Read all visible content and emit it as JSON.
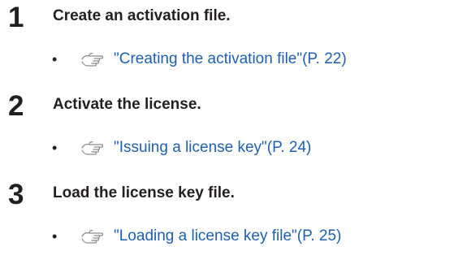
{
  "steps": [
    {
      "number": "1",
      "title": "Create an activation file.",
      "reference": {
        "icon": "reference-hand-icon",
        "link_text": "\"Creating the activation file\"(P. 22)"
      }
    },
    {
      "number": "2",
      "title": "Activate the license.",
      "reference": {
        "icon": "reference-hand-icon",
        "link_text": "\"Issuing a license key\"(P. 24)"
      }
    },
    {
      "number": "3",
      "title": "Load the license key file.",
      "reference": {
        "icon": "reference-hand-icon",
        "link_text": "\"Loading a license key file\"(P. 25)"
      }
    }
  ],
  "colors": {
    "text": "#231f20",
    "link": "#1f5fb0",
    "icon_stroke": "#8c8c8c"
  }
}
